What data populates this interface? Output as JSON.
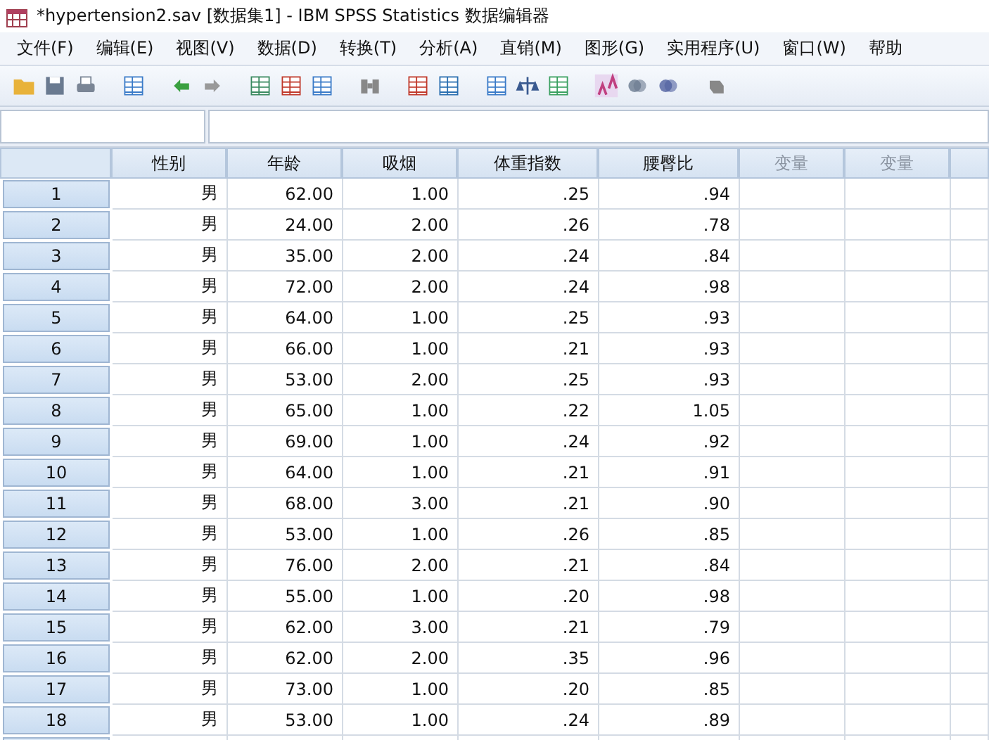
{
  "window": {
    "title": "*hypertension2.sav [数据集1] - IBM SPSS Statistics 数据编辑器"
  },
  "menu": [
    {
      "label": "文件(F)"
    },
    {
      "label": "编辑(E)"
    },
    {
      "label": "视图(V)"
    },
    {
      "label": "数据(D)"
    },
    {
      "label": "转换(T)"
    },
    {
      "label": "分析(A)"
    },
    {
      "label": "直销(M)"
    },
    {
      "label": "图形(G)"
    },
    {
      "label": "实用程序(U)"
    },
    {
      "label": "窗口(W)"
    },
    {
      "label": "帮助"
    }
  ],
  "table": {
    "columns": [
      {
        "label": "性别",
        "kind": "defined"
      },
      {
        "label": "年龄",
        "kind": "defined"
      },
      {
        "label": "吸烟",
        "kind": "defined"
      },
      {
        "label": "体重指数",
        "kind": "defined"
      },
      {
        "label": "腰臀比",
        "kind": "defined"
      },
      {
        "label": "变量",
        "kind": "empty"
      },
      {
        "label": "变量",
        "kind": "empty"
      }
    ],
    "rows": [
      {
        "number": "1",
        "cells": [
          "男",
          "62.00",
          "1.00",
          ".25",
          ".94"
        ]
      },
      {
        "number": "2",
        "cells": [
          "男",
          "24.00",
          "2.00",
          ".26",
          ".78"
        ]
      },
      {
        "number": "3",
        "cells": [
          "男",
          "35.00",
          "2.00",
          ".24",
          ".84"
        ]
      },
      {
        "number": "4",
        "cells": [
          "男",
          "72.00",
          "2.00",
          ".24",
          ".98"
        ]
      },
      {
        "number": "5",
        "cells": [
          "男",
          "64.00",
          "1.00",
          ".25",
          ".93"
        ]
      },
      {
        "number": "6",
        "cells": [
          "男",
          "66.00",
          "1.00",
          ".21",
          ".93"
        ]
      },
      {
        "number": "7",
        "cells": [
          "男",
          "53.00",
          "2.00",
          ".25",
          ".93"
        ]
      },
      {
        "number": "8",
        "cells": [
          "男",
          "65.00",
          "1.00",
          ".22",
          "1.05"
        ]
      },
      {
        "number": "9",
        "cells": [
          "男",
          "69.00",
          "1.00",
          ".24",
          ".92"
        ]
      },
      {
        "number": "10",
        "cells": [
          "男",
          "64.00",
          "1.00",
          ".21",
          ".91"
        ]
      },
      {
        "number": "11",
        "cells": [
          "男",
          "68.00",
          "3.00",
          ".21",
          ".90"
        ]
      },
      {
        "number": "12",
        "cells": [
          "男",
          "53.00",
          "1.00",
          ".26",
          ".85"
        ]
      },
      {
        "number": "13",
        "cells": [
          "男",
          "76.00",
          "2.00",
          ".21",
          ".84"
        ]
      },
      {
        "number": "14",
        "cells": [
          "男",
          "55.00",
          "1.00",
          ".20",
          ".98"
        ]
      },
      {
        "number": "15",
        "cells": [
          "男",
          "62.00",
          "3.00",
          ".21",
          ".79"
        ]
      },
      {
        "number": "16",
        "cells": [
          "男",
          "62.00",
          "2.00",
          ".35",
          ".96"
        ]
      },
      {
        "number": "17",
        "cells": [
          "男",
          "73.00",
          "1.00",
          ".20",
          ".85"
        ]
      },
      {
        "number": "18",
        "cells": [
          "男",
          "53.00",
          "1.00",
          ".24",
          ".89"
        ]
      }
    ]
  }
}
